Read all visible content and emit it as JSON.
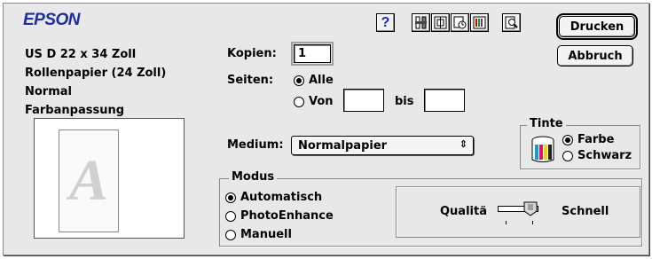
{
  "brand": {
    "name": "EPSON",
    "color": "#1d2f9e"
  },
  "toolbar": {
    "icons": [
      "help-icon",
      "tool-icon",
      "layout-icon",
      "page-setup-icon",
      "color-icon",
      "preview-icon"
    ],
    "help_label": "?"
  },
  "buttons": {
    "print": "Drucken",
    "cancel": "Abbruch"
  },
  "settings_summary": {
    "lines": [
      "US D 22 x 34 Zoll",
      "Rollenpapier (24 Zoll)",
      "Normal",
      "Farbanpassung"
    ]
  },
  "preview": {
    "letter": "A"
  },
  "copies": {
    "label": "Kopien:",
    "value": "1"
  },
  "pages": {
    "label": "Seiten:",
    "all_label": "Alle",
    "from_label": "Von",
    "to_label": "bis",
    "selected": "all",
    "from_value": "",
    "to_value": ""
  },
  "media": {
    "label": "Medium:",
    "value": "Normalpapier"
  },
  "ink": {
    "title": "Tinte",
    "options": [
      "Farbe",
      "Schwarz"
    ],
    "selected": "Farbe"
  },
  "mode": {
    "title": "Modus",
    "options": [
      "Automatisch",
      "PhotoEnhance",
      "Manuell"
    ],
    "selected": "Automatisch"
  },
  "quality_speed": {
    "left_label": "Qualitä",
    "right_label": "Schnell",
    "level_fraction": 0.85
  }
}
